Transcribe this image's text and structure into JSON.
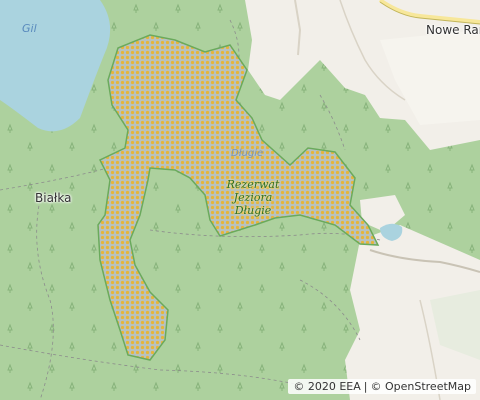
{
  "map": {
    "labels": {
      "lake_gil": "Gil",
      "town_nowe": "Nowe Ram",
      "town_bialka": "Białka",
      "lake_small": "Długie",
      "reserve_line1": "Rezerwat",
      "reserve_line2": "Jeziora",
      "reserve_line3": "Długie"
    },
    "attribution": {
      "eea": "© 2020 EEA",
      "separator": "|",
      "osm": "© OpenStreetMap"
    },
    "colors": {
      "forest": "#add19e",
      "farmland": "#f2efe9",
      "water": "#aad3df",
      "reserve_fill": "#e3c54a",
      "reserve_outline": "#6aaa5c"
    }
  }
}
